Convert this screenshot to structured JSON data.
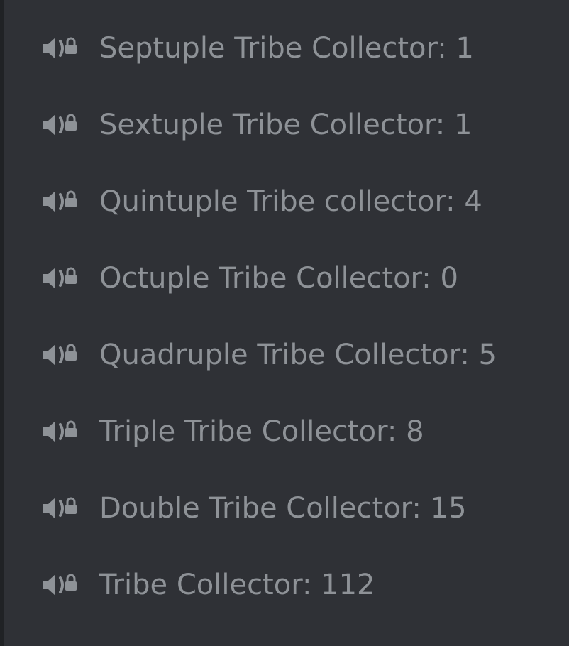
{
  "colors": {
    "background": "#2f3136",
    "edge": "#202225",
    "text": "#8e9297",
    "icon": "#8e9297"
  },
  "icon": "locked-voice-channel-icon",
  "channels": [
    {
      "label": "Septuple Tribe Collector: 1"
    },
    {
      "label": "Sextuple Tribe Collector: 1"
    },
    {
      "label": "Quintuple Tribe collector: 4"
    },
    {
      "label": "Octuple Tribe Collector: 0"
    },
    {
      "label": "Quadruple Tribe Collector: 5"
    },
    {
      "label": "Triple Tribe Collector: 8"
    },
    {
      "label": "Double Tribe Collector: 15"
    },
    {
      "label": "Tribe Collector: 112"
    }
  ]
}
